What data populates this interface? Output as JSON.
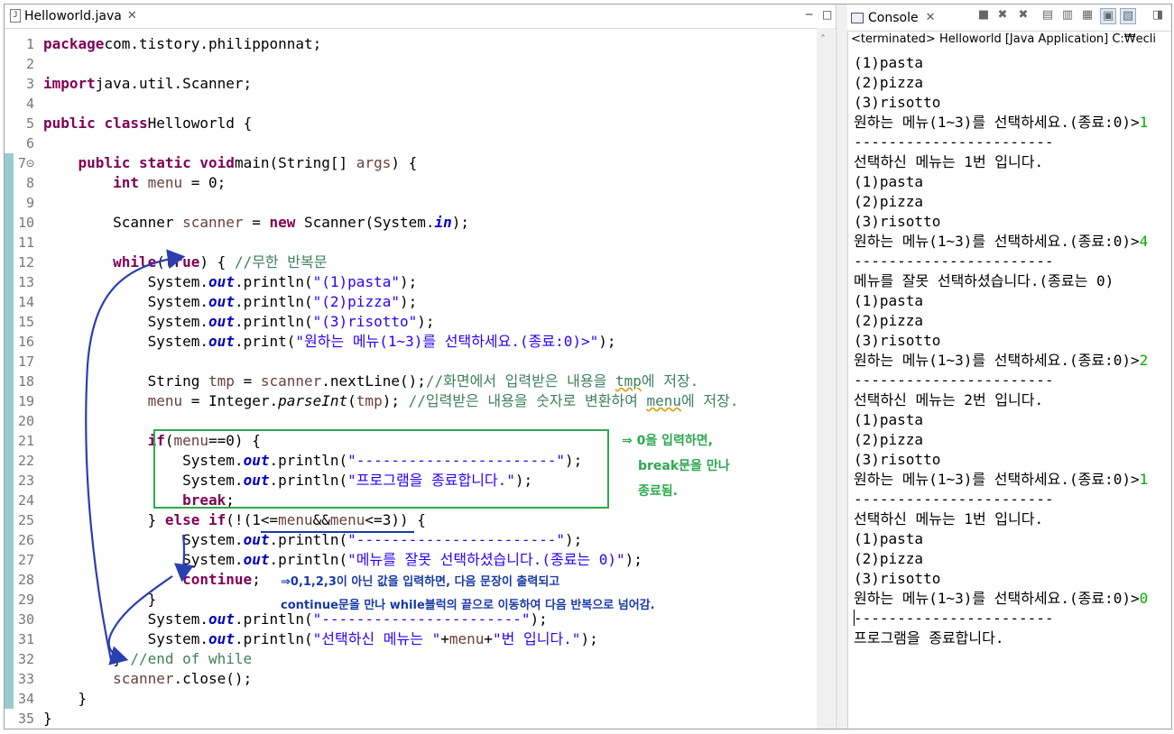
{
  "editor": {
    "tab_label": "Helloworld.java",
    "tab_close": "✕",
    "minimize": "─",
    "maximize": "□",
    "scroll_up": "˄"
  },
  "code_lines": [
    {
      "n": "1",
      "parts": [
        [
          "kw",
          "package"
        ],
        [
          "",
          "com.tistory.philipponnat;"
        ]
      ]
    },
    {
      "n": "2",
      "parts": []
    },
    {
      "n": "3",
      "parts": [
        [
          "kw",
          "import"
        ],
        [
          "",
          "java.util.Scanner;"
        ]
      ]
    },
    {
      "n": "4",
      "parts": []
    },
    {
      "n": "5",
      "parts": [
        [
          "kw",
          "public"
        ],
        [
          "",
          ""
        ],
        [
          "kw",
          "class"
        ],
        [
          "",
          "Helloworld {"
        ]
      ]
    },
    {
      "n": "6",
      "parts": []
    },
    {
      "n": "7⊝",
      "parts": [
        [
          "",
          "    "
        ],
        [
          "kw",
          "public"
        ],
        [
          "",
          ""
        ],
        [
          "kw",
          "static"
        ],
        [
          "",
          ""
        ],
        [
          "kw",
          "void"
        ],
        [
          "",
          "main(String[] "
        ],
        [
          "var",
          "args"
        ],
        [
          "",
          ") {"
        ]
      ]
    },
    {
      "n": "8",
      "parts": [
        [
          "",
          "        "
        ],
        [
          "kw",
          "int"
        ],
        [
          "",
          ""
        ],
        [
          "var",
          "menu"
        ],
        [
          "",
          ""
        ],
        [
          "",
          "= 0;"
        ]
      ]
    },
    {
      "n": "9",
      "parts": []
    },
    {
      "n": "10",
      "parts": [
        [
          "",
          "        Scanner "
        ],
        [
          "var",
          "scanner"
        ],
        [
          "",
          ""
        ],
        [
          "",
          "= "
        ],
        [
          "kw",
          "new"
        ],
        [
          "",
          ""
        ],
        [
          "",
          "Scanner(System."
        ],
        [
          "fld",
          "in"
        ],
        [
          "",
          ");"
        ]
      ]
    },
    {
      "n": "11",
      "parts": []
    },
    {
      "n": "12",
      "parts": [
        [
          "",
          "        "
        ],
        [
          "kw",
          "while"
        ],
        [
          "",
          "("
        ],
        [
          "kw",
          "true"
        ],
        [
          "",
          ") { "
        ],
        [
          "cmt",
          "//무한 반복문"
        ]
      ]
    },
    {
      "n": "13",
      "parts": [
        [
          "",
          "            System."
        ],
        [
          "fld",
          "out"
        ],
        [
          "",
          ".println("
        ],
        [
          "str",
          "\"(1)pasta\""
        ],
        [
          "",
          ");"
        ]
      ]
    },
    {
      "n": "14",
      "parts": [
        [
          "",
          "            System."
        ],
        [
          "fld",
          "out"
        ],
        [
          "",
          ".println("
        ],
        [
          "str",
          "\"(2)pizza\""
        ],
        [
          "",
          ");"
        ]
      ]
    },
    {
      "n": "15",
      "parts": [
        [
          "",
          "            System."
        ],
        [
          "fld",
          "out"
        ],
        [
          "",
          ".println("
        ],
        [
          "str",
          "\"(3)risotto\""
        ],
        [
          "",
          ");"
        ]
      ]
    },
    {
      "n": "16",
      "parts": [
        [
          "",
          "            System."
        ],
        [
          "fld",
          "out"
        ],
        [
          "",
          ".print("
        ],
        [
          "str",
          "\"원하는 메뉴(1~3)를 선택하세요.(종료:0)>\""
        ],
        [
          "",
          ");"
        ]
      ]
    },
    {
      "n": "17",
      "parts": []
    },
    {
      "n": "18",
      "parts": [
        [
          "",
          "            String "
        ],
        [
          "var",
          "tmp"
        ],
        [
          "",
          ""
        ],
        [
          "",
          "= "
        ],
        [
          "var",
          "scanner"
        ],
        [
          "",
          ".nextLine();"
        ],
        [
          "cmt",
          "//화면에서 입력받은 내용을 "
        ],
        [
          "cmtw",
          "tmp"
        ],
        [
          "cmt",
          "에 저장."
        ]
      ]
    },
    {
      "n": "19",
      "parts": [
        [
          "",
          "            "
        ],
        [
          "var",
          "menu"
        ],
        [
          "",
          ""
        ],
        [
          "",
          "= Integer."
        ],
        [
          "ita",
          "parseInt"
        ],
        [
          "",
          "("
        ],
        [
          "var",
          "tmp"
        ],
        [
          "",
          "); "
        ],
        [
          "cmt",
          "//입력받은 내용을 숫자로 변환하여 "
        ],
        [
          "cmtw",
          "menu"
        ],
        [
          "cmt",
          "에 저장."
        ]
      ]
    },
    {
      "n": "20",
      "parts": []
    },
    {
      "n": "21",
      "parts": [
        [
          "",
          "            "
        ],
        [
          "kw",
          "if"
        ],
        [
          "",
          "("
        ],
        [
          "var",
          "menu"
        ],
        [
          "",
          "==0) {"
        ]
      ]
    },
    {
      "n": "22",
      "parts": [
        [
          "",
          "                System."
        ],
        [
          "fld",
          "out"
        ],
        [
          "",
          ".println("
        ],
        [
          "str",
          "\"-----------------------\""
        ],
        [
          "",
          ");"
        ]
      ]
    },
    {
      "n": "23",
      "parts": [
        [
          "",
          "                System."
        ],
        [
          "fld",
          "out"
        ],
        [
          "",
          ".println("
        ],
        [
          "str",
          "\"프로그램을 종료합니다.\""
        ],
        [
          "",
          ");"
        ]
      ]
    },
    {
      "n": "24",
      "parts": [
        [
          "",
          "                "
        ],
        [
          "kw",
          "break"
        ],
        [
          "",
          ";"
        ]
      ]
    },
    {
      "n": "25",
      "parts": [
        [
          "",
          "            } "
        ],
        [
          "kw",
          "else"
        ],
        [
          "",
          ""
        ],
        [
          "kw",
          "if"
        ],
        [
          "",
          "(!(1<="
        ],
        [
          "var",
          "menu"
        ],
        [
          "",
          "&&"
        ],
        [
          "var",
          "menu"
        ],
        [
          "",
          "<=3)) {"
        ]
      ]
    },
    {
      "n": "26",
      "parts": [
        [
          "",
          "                System."
        ],
        [
          "fld",
          "out"
        ],
        [
          "",
          ".println("
        ],
        [
          "str",
          "\"-----------------------\""
        ],
        [
          "",
          ");"
        ]
      ]
    },
    {
      "n": "27",
      "parts": [
        [
          "",
          "                System."
        ],
        [
          "fld",
          "out"
        ],
        [
          "",
          ".println("
        ],
        [
          "str",
          "\"메뉴를 잘못 선택하셨습니다.(종료는 0)\""
        ],
        [
          "",
          ");"
        ]
      ]
    },
    {
      "n": "28",
      "parts": [
        [
          "",
          "                "
        ],
        [
          "kw",
          "continue"
        ],
        [
          "",
          ";"
        ]
      ]
    },
    {
      "n": "29",
      "parts": [
        [
          "",
          "            }"
        ]
      ]
    },
    {
      "n": "30",
      "parts": [
        [
          "",
          "            System."
        ],
        [
          "fld",
          "out"
        ],
        [
          "",
          ".println("
        ],
        [
          "str",
          "\"-----------------------\""
        ],
        [
          "",
          ");"
        ]
      ]
    },
    {
      "n": "31",
      "parts": [
        [
          "",
          "            System."
        ],
        [
          "fld",
          "out"
        ],
        [
          "",
          ".println("
        ],
        [
          "str",
          "\"선택하신 메뉴는 \""
        ],
        [
          "",
          "+"
        ],
        [
          "var",
          "menu"
        ],
        [
          "",
          "+"
        ],
        [
          "str",
          "\"번 입니다.\""
        ],
        [
          "",
          ");"
        ]
      ]
    },
    {
      "n": "32",
      "parts": [
        [
          "",
          "        } "
        ],
        [
          "cmt",
          "//end of while"
        ]
      ]
    },
    {
      "n": "33",
      "parts": [
        [
          "",
          "        "
        ],
        [
          "var",
          "scanner"
        ],
        [
          "",
          ".close();"
        ]
      ]
    },
    {
      "n": "34",
      "parts": [
        [
          "",
          "    }"
        ]
      ]
    },
    {
      "n": "35",
      "parts": [
        [
          "",
          "}"
        ]
      ]
    }
  ],
  "annotations": {
    "break_line1": "⇒ 0을 입력하면,",
    "break_line2": "break문을 만나",
    "break_line3": "종료됨.",
    "continue_line1": "⇒0,1,2,3이 아닌 값을 입력하면, 다음 문장이 출력되고",
    "continue_line2": "continue문을 만나 while블럭의 끝으로 이동하여 다음 반복으로 넘어감."
  },
  "console": {
    "tab_label": "Console",
    "tab_close": "✕",
    "status": "<terminated> Helloworld [Java Application] C:₩ecli",
    "output": [
      {
        "t": "(1)pasta"
      },
      {
        "t": "(2)pizza"
      },
      {
        "t": "(3)risotto"
      },
      {
        "t": "원하는 메뉴(1~3)를 선택하세요.(종료:0)>",
        "in": "1"
      },
      {
        "t": "-----------------------"
      },
      {
        "t": "선택하신 메뉴는 1번 입니다."
      },
      {
        "t": "(1)pasta"
      },
      {
        "t": "(2)pizza"
      },
      {
        "t": "(3)risotto"
      },
      {
        "t": "원하는 메뉴(1~3)를 선택하세요.(종료:0)>",
        "in": "4"
      },
      {
        "t": "-----------------------"
      },
      {
        "t": "메뉴를 잘못 선택하셨습니다.(종료는 0)"
      },
      {
        "t": "(1)pasta"
      },
      {
        "t": "(2)pizza"
      },
      {
        "t": "(3)risotto"
      },
      {
        "t": "원하는 메뉴(1~3)를 선택하세요.(종료:0)>",
        "in": "2"
      },
      {
        "t": "-----------------------"
      },
      {
        "t": "선택하신 메뉴는 2번 입니다."
      },
      {
        "t": "(1)pasta"
      },
      {
        "t": "(2)pizza"
      },
      {
        "t": "(3)risotto"
      },
      {
        "t": "원하는 메뉴(1~3)를 선택하세요.(종료:0)>",
        "in": "1"
      },
      {
        "t": "-----------------------"
      },
      {
        "t": "선택하신 메뉴는 1번 입니다."
      },
      {
        "t": "(1)pasta"
      },
      {
        "t": "(2)pizza"
      },
      {
        "t": "(3)risotto"
      },
      {
        "t": "원하는 메뉴(1~3)를 선택하세요.(종료:0)>",
        "in": "0"
      },
      {
        "t": "-----------------------"
      },
      {
        "t": "프로그램을 종료합니다."
      }
    ],
    "toolbar_icons": [
      "terminate-icon",
      "remove-launch-icon",
      "remove-all-terminated-icon",
      "scroll-lock-icon",
      "show-on-output-icon",
      "word-wrap-icon",
      "pin-console-icon",
      "display-selected-console-icon",
      "open-console-icon"
    ]
  }
}
